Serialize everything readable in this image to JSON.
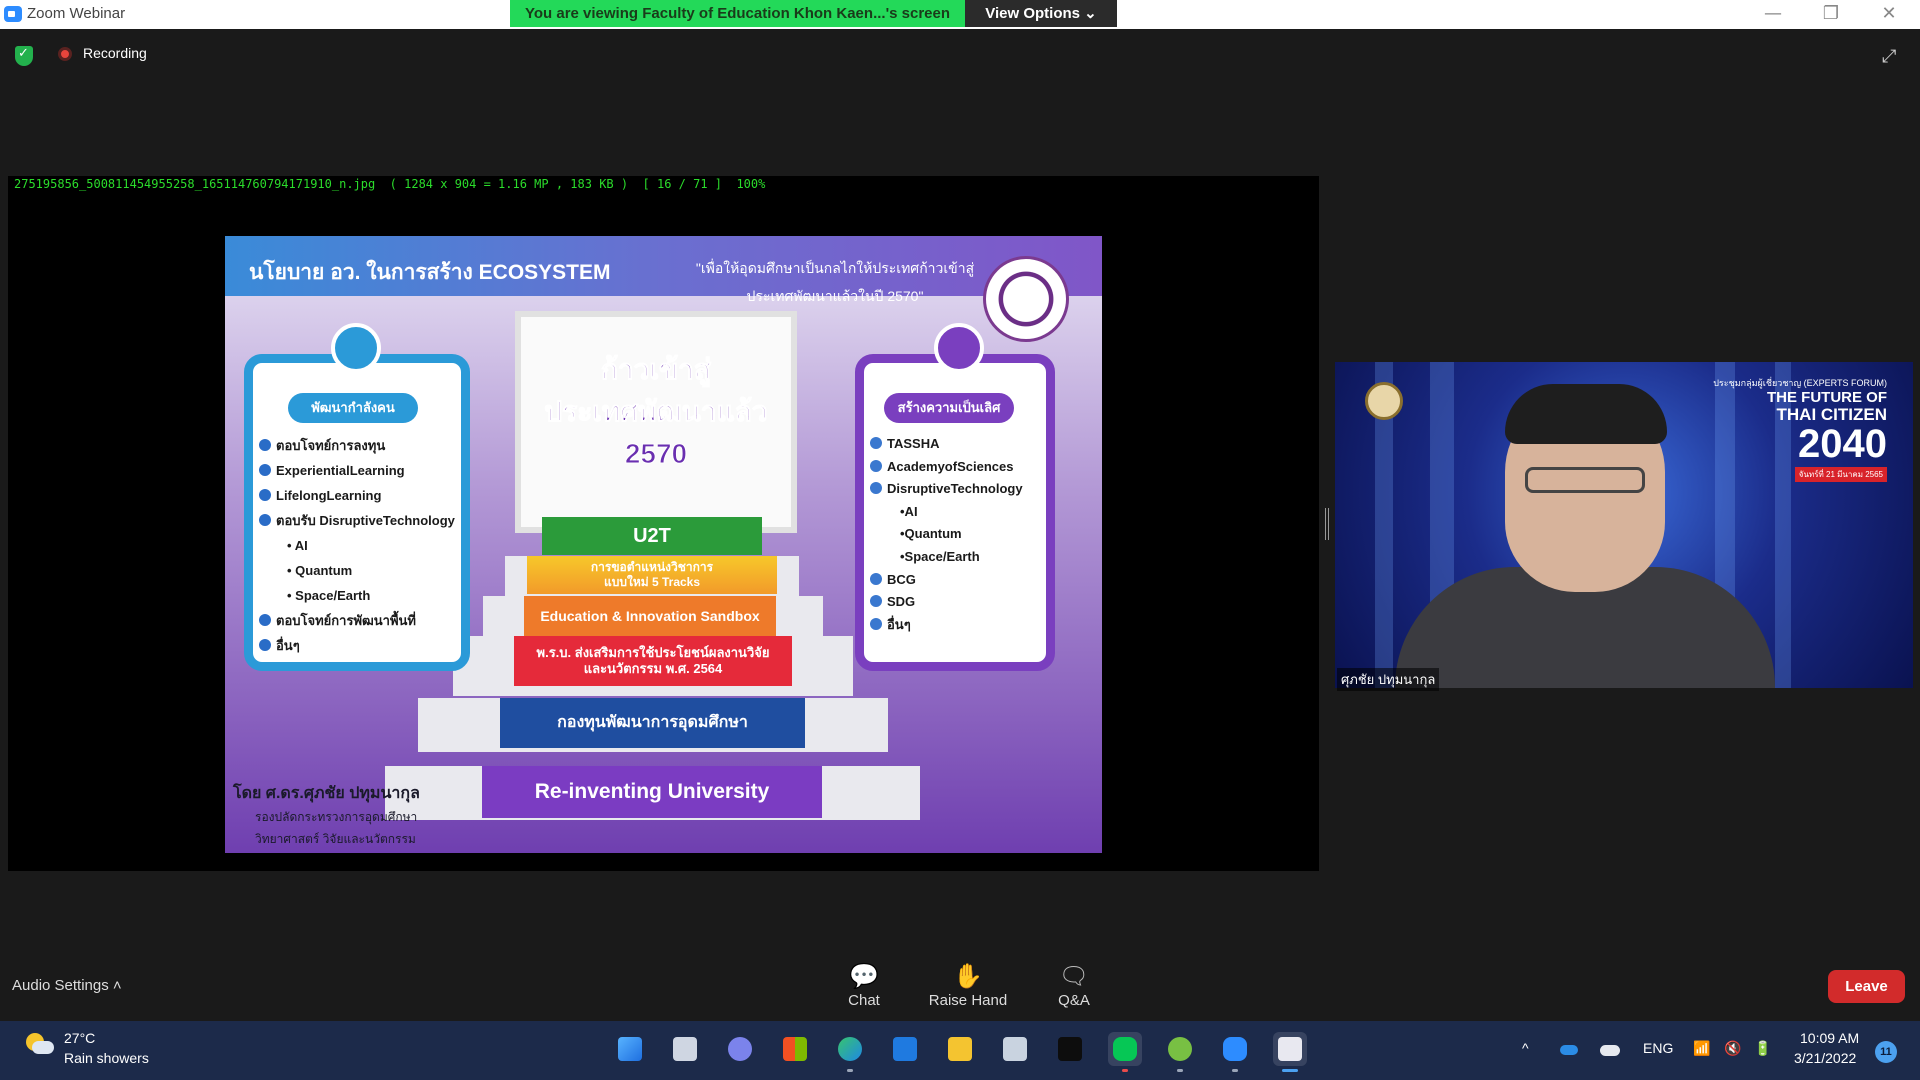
{
  "window": {
    "title": "Zoom Webinar",
    "share_banner": "You are viewing Faculty of Education Khon Kaen...'s screen",
    "view_options": "View Options ⌄",
    "minimize": "—",
    "restore": "❐",
    "close": "✕"
  },
  "meeting": {
    "recording_label": "Recording",
    "fullscreen_glyph": "⤢"
  },
  "shared": {
    "file_info": "275195856_500811454955258_165114760794171910_n.jpg  ( 1284 x 904 = 1.16 MP , 183 KB )  [ 16 / 71 ]  100%"
  },
  "slide": {
    "title": "นโยบาย อว. ในการสร้าง ECOSYSTEM",
    "quote_line1": "\"เพื่อให้อุดมศึกษาเป็นกลไกให้ประเทศก้าวเข้าสู่",
    "quote_line2": "ประเทศพัฒนาแล้วในปี 2570\"",
    "left_panel": {
      "badge": "พัฒนากำลังคน",
      "items": [
        "ตอบโจทย์การลงทุน",
        "ExperientialLearning",
        "LifelongLearning",
        "ตอบรับ DisruptiveTechnology",
        "AI",
        "Quantum",
        "Space/Earth",
        "ตอบโจทย์การพัฒนาพื้นที่",
        "อื่นๆ"
      ]
    },
    "right_panel": {
      "badge": "สร้างความเป็นเลิศ",
      "items": [
        "TASSHA",
        "AcademyofSciences",
        "DisruptiveTechnology",
        "•AI",
        "•Quantum",
        "•Space/Earth",
        "BCG",
        "SDG",
        "อื่นๆ"
      ]
    },
    "door_line1": "ก้าวเข้าสู่",
    "door_line2": "ประเทศพัฒนาแล้ว",
    "door_line3": "2570",
    "steps": {
      "u2t": "U2T",
      "tracks_line1": "การขอตำแหน่งวิชาการ",
      "tracks_line2": "แบบใหม่ 5 Tracks",
      "sandbox": "Education & Innovation Sandbox",
      "act_line1": "พ.ร.บ. ส่งเสริมการใช้ประโยชน์ผลงานวิจัย",
      "act_line2": "และนวัตกรรม พ.ศ. 2564",
      "fund": "กองทุนพัฒนาการอุดมศึกษา",
      "reinvent": "Re-inventing University"
    },
    "author_line1": "โดย ศ.ดร.ศุภชัย ปทุมนากุล",
    "author_line2": "รองปลัดกระทรวงการอุดมศึกษา",
    "author_line3": "วิทยาศาสตร์ วิจัยและนวัตกรรม"
  },
  "video": {
    "org_line1": "ประชุมกลุ่มผู้เชี่ยวชาญ (EXPERTS FORUM)",
    "org_line2": "THE FUTURE OF",
    "org_line3": "THAI CITIZEN",
    "org_line4": "2040",
    "org_line5": "จันทร์ที่ 21 มีนาคม 2565",
    "speaker_name": "ศุภชัย ปทุมนากุล"
  },
  "controls": {
    "audio_settings": "Audio Settings ˄",
    "chat": "Chat",
    "raise_hand": "Raise Hand",
    "qa": "Q&A",
    "leave": "Leave"
  },
  "taskbar": {
    "weather_temp": "27°C",
    "weather_desc": "Rain showers",
    "tray_chevron": "^",
    "language": "ENG",
    "time": "10:09 AM",
    "date": "3/21/2022",
    "notifications": "11"
  },
  "colors": {
    "banner_green": "#23d959",
    "leave_red": "#d22b2b",
    "taskbar": "#1c2a4a"
  }
}
